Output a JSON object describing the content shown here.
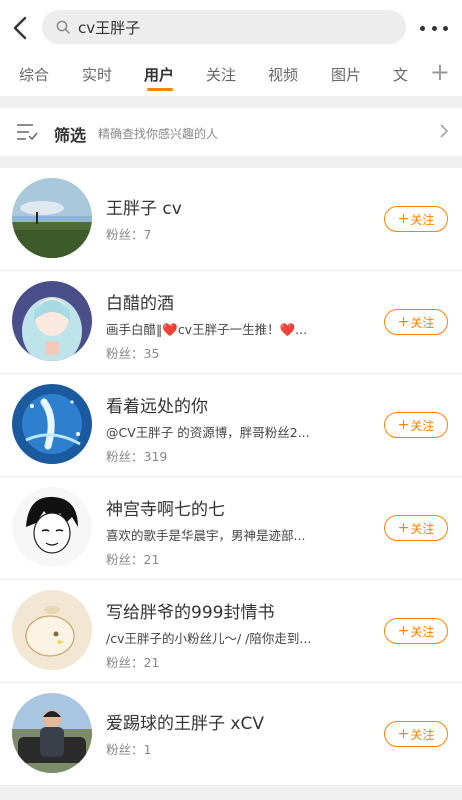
{
  "search": {
    "query": "cv王胖子"
  },
  "tabs": [
    {
      "label": "综合"
    },
    {
      "label": "实时"
    },
    {
      "label": "用户"
    },
    {
      "label": "关注"
    },
    {
      "label": "视频"
    },
    {
      "label": "图片"
    },
    {
      "label": "文"
    }
  ],
  "active_tab": "用户",
  "tab_plus": "+",
  "filter": {
    "label": "筛选",
    "hint": "精确查找你感兴趣的人"
  },
  "users": [
    {
      "name": "王胖子 cv",
      "desc": "",
      "fans": "粉丝：7",
      "follow": "关注"
    },
    {
      "name": "白醋的酒",
      "desc": "画手白醋‖❤️cv王胖子一生推！❤️...",
      "fans": "粉丝：35",
      "follow": "关注"
    },
    {
      "name": "看着远处的你",
      "desc": "@CV王胖子 的资源博，胖哥粉丝2...",
      "fans": "粉丝：319",
      "follow": "关注"
    },
    {
      "name": "神宫寺啊七的七",
      "desc": "喜欢的歌手是华晨宇，男神是迹部...",
      "fans": "粉丝：21",
      "follow": "关注"
    },
    {
      "name": "写给胖爷的999封情书",
      "desc": "/cv王胖子的小粉丝儿～/ /陪你走到...",
      "fans": "粉丝：21",
      "follow": "关注"
    },
    {
      "name": "爱踢球的王胖子 xCV",
      "desc": "",
      "fans": "粉丝：1",
      "follow": "关注"
    }
  ],
  "follow_plus": "+",
  "colors": {
    "accent": "#ff8200",
    "bg": "#efefef"
  }
}
